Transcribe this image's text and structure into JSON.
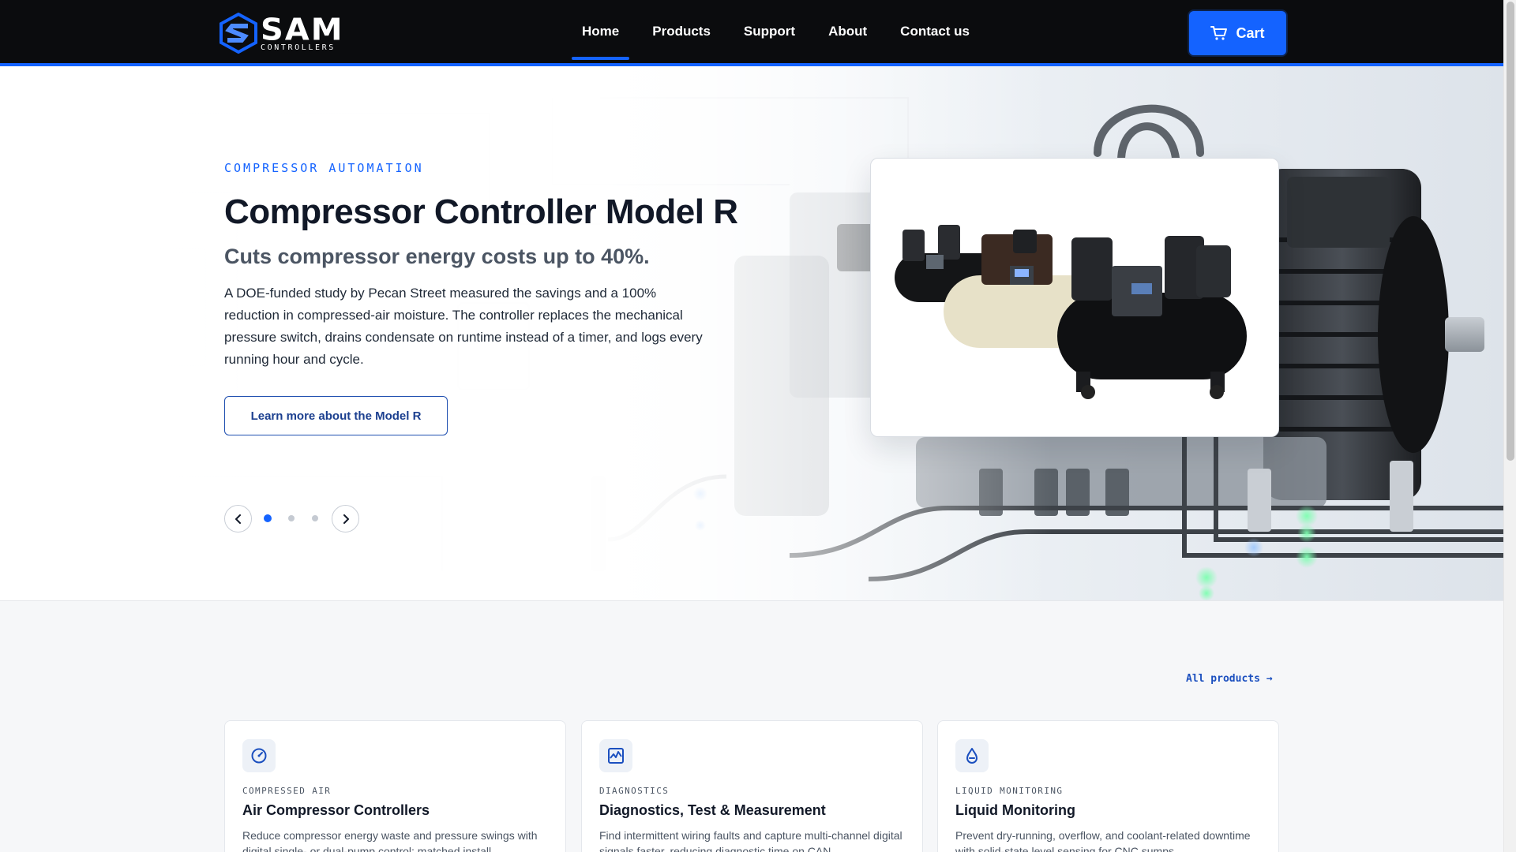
{
  "brand": {
    "name": "SAM",
    "tagline": "CONTROLLERS",
    "accent": "#1463ff",
    "header_bg": "#0b0c0e"
  },
  "nav": {
    "items": [
      {
        "label": "Home",
        "active": true
      },
      {
        "label": "Products"
      },
      {
        "label": "Support"
      },
      {
        "label": "About"
      },
      {
        "label": "Contact us"
      }
    ],
    "cart_label": "Cart",
    "cart_icon": "cart-icon"
  },
  "hero": {
    "eyebrow": "COMPRESSOR AUTOMATION",
    "title": "Compressor Controller Model R",
    "subtitle": "Cuts compressor energy costs up to 40%.",
    "body": "A DOE-funded study by Pecan Street measured the savings and a 100% reduction in compressed-air moisture. The controller replaces the mechanical pressure switch, drains condensate on runtime instead of a timer, and logs every running hour and cycle.",
    "cta_label": "Learn more about the Model R",
    "prev_icon": "chevron-left-icon",
    "next_icon": "chevron-right-icon",
    "slides_total": 3,
    "active_slide": 1
  },
  "products": {
    "all_link": "All products →",
    "cards": [
      {
        "icon": "gauge-icon",
        "eyebrow": "COMPRESSED AIR",
        "title": "Air Compressor Controllers",
        "description": "Reduce compressor energy waste and pressure swings with digital single- or dual-pump control; matched install"
      },
      {
        "icon": "waveform-icon",
        "eyebrow": "DIAGNOSTICS",
        "title": "Diagnostics, Test & Measurement",
        "description": "Find intermittent wiring faults and capture multi-channel digital signals faster, reducing diagnostic time on CAN"
      },
      {
        "icon": "droplet-icon",
        "eyebrow": "LIQUID MONITORING",
        "title": "Liquid Monitoring",
        "description": "Prevent dry-running, overflow, and coolant-related downtime with solid-state level sensing for CNC sumps"
      }
    ]
  }
}
